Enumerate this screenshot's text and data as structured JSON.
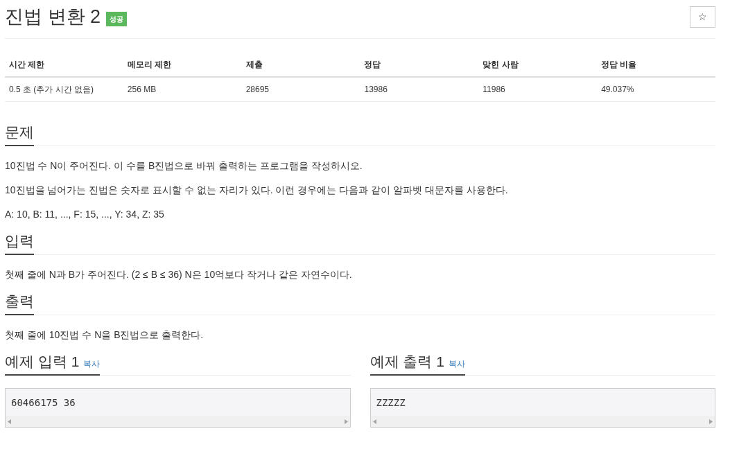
{
  "title": "진법 변환 2",
  "badge": "성공",
  "star": "☆",
  "info_table": {
    "columns": [
      "시간 제한",
      "메모리 제한",
      "제출",
      "정답",
      "맞힌 사람",
      "정답 비율"
    ],
    "rows": [
      [
        "0.5 초 (추가 시간 없음)",
        "256 MB",
        "28695",
        "13986",
        "11986",
        "49.037%"
      ]
    ]
  },
  "sections": [
    {
      "heading": "문제",
      "paragraphs": [
        "10진법 수 N이 주어진다. 이 수를 B진법으로 바꿔 출력하는 프로그램을 작성하시오.",
        "10진법을 넘어가는 진법은 숫자로 표시할 수 없는 자리가 있다. 이런 경우에는 다음과 같이 알파벳 대문자를 사용한다.",
        "A: 10, B: 11, ..., F: 15, ..., Y: 34, Z: 35"
      ]
    },
    {
      "heading": "입력",
      "paragraphs": [
        "첫째 줄에 N과 B가 주어진다. (2 ≤ B ≤ 36) N은 10억보다 작거나 같은 자연수이다."
      ]
    },
    {
      "heading": "출력",
      "paragraphs": [
        "첫째 줄에 10진법 수 N을 B진법으로 출력한다."
      ]
    }
  ],
  "samples": [
    {
      "heading": "예제 입력 1",
      "copy": "복사",
      "content": "60466175 36"
    },
    {
      "heading": "예제 출력 1",
      "copy": "복사",
      "content": "ZZZZZ"
    }
  ]
}
